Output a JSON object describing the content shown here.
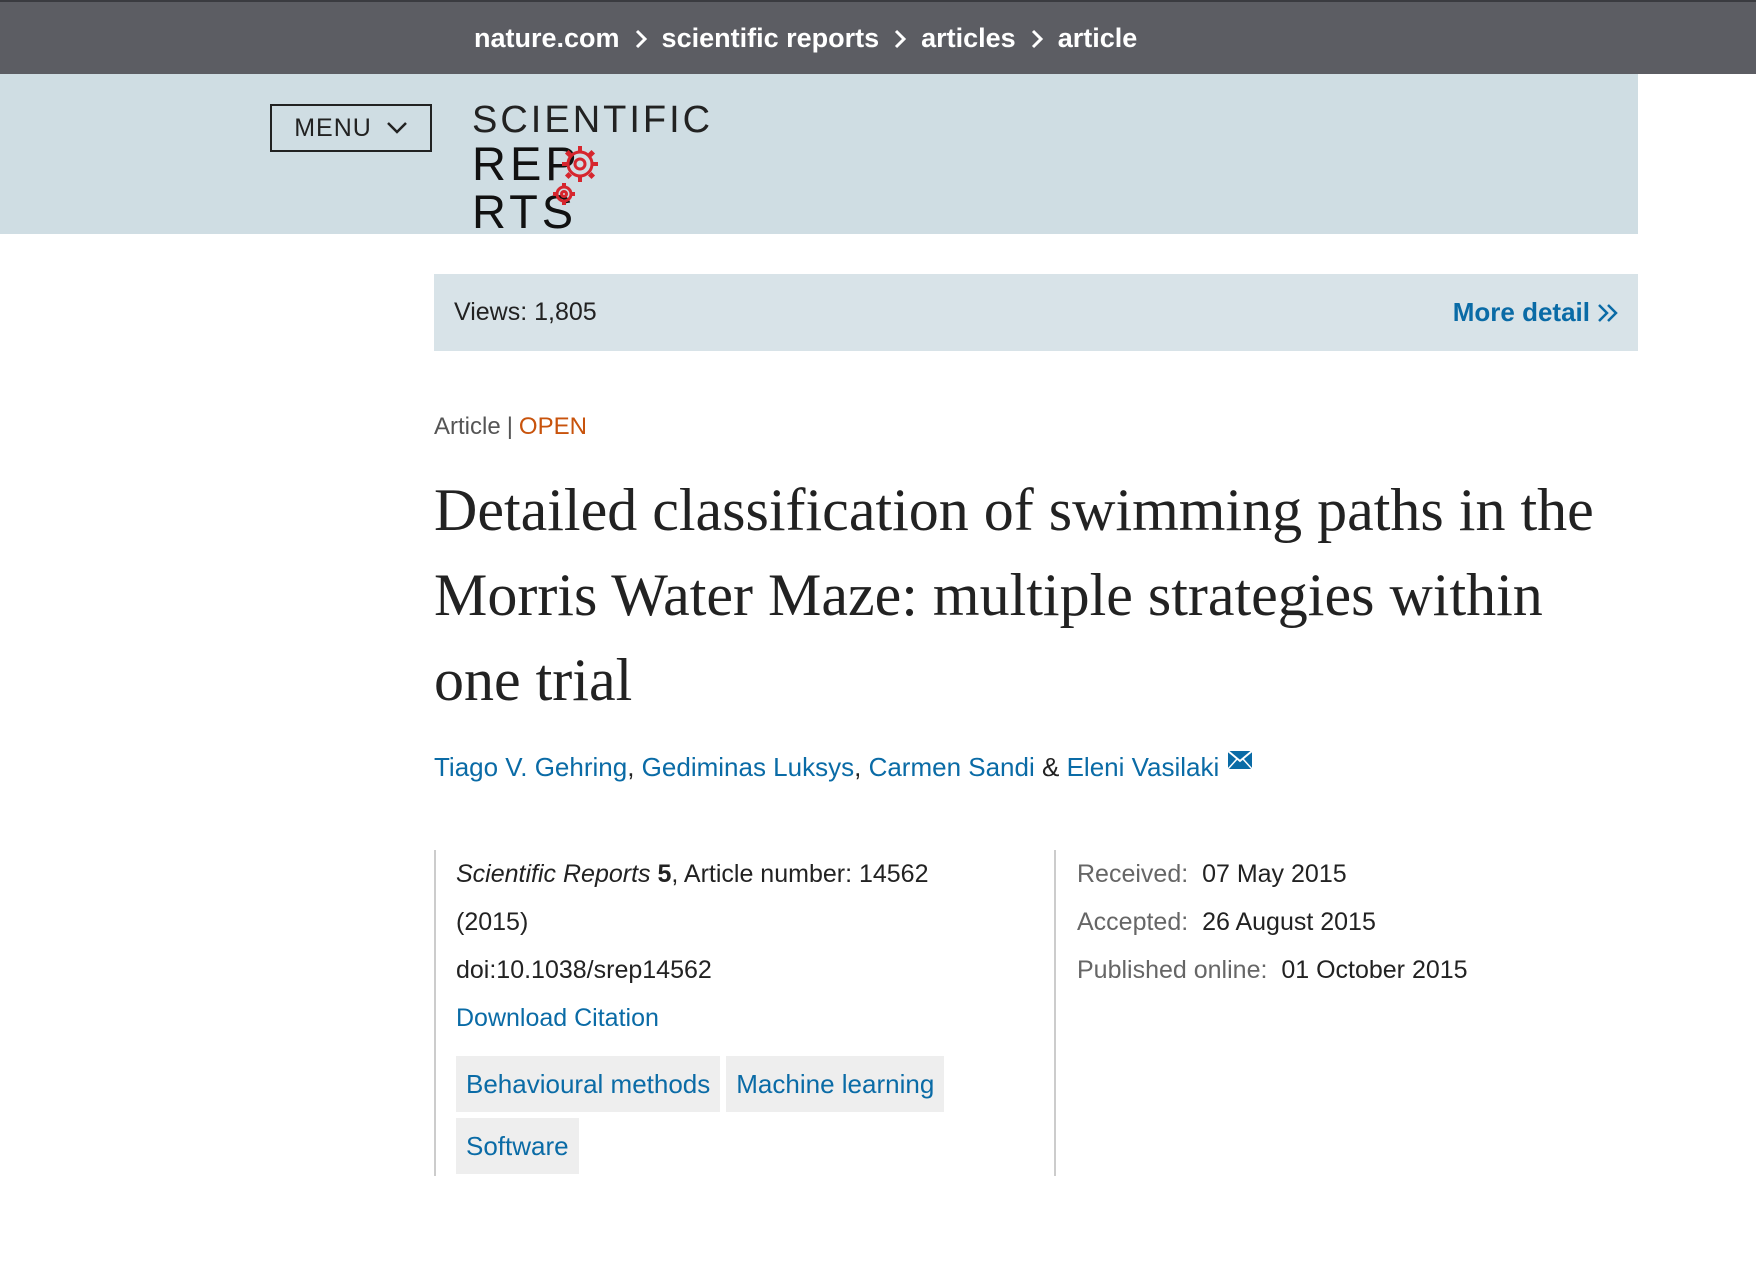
{
  "breadcrumb": {
    "items": [
      "nature.com",
      "scientific reports",
      "articles",
      "article"
    ]
  },
  "header": {
    "menu_label": "MENU",
    "logo_top": "SCIENTIFIC",
    "logo_bottom_left": "REP",
    "logo_bottom_right": "RTS",
    "logo_gear_color": "#d6262e"
  },
  "views": {
    "label": "Views: 1,805",
    "more_detail": "More detail"
  },
  "article": {
    "type": "Article",
    "separator": "|",
    "access": "OPEN",
    "title": "Detailed classification of swimming paths in the Morris Water Maze: multiple strategies within one trial",
    "authors": [
      "Tiago V. Gehring",
      "Gediminas Luksys",
      "Carmen Sandi",
      "Eleni Vasilaki"
    ],
    "author_sep_comma": ",",
    "author_sep_and": "&",
    "journal": "Scientific Reports",
    "volume": "5",
    "article_number": ", Article number: 14562",
    "year": "(2015)",
    "doi": "doi:10.1038/srep14562",
    "download_citation": "Download Citation",
    "subjects": [
      "Behavioural methods",
      "Machine learning",
      "Software"
    ]
  },
  "dates": {
    "received_label": "Received:",
    "received": "07 May 2015",
    "accepted_label": "Accepted:",
    "accepted": "26 August 2015",
    "published_label": "Published online:",
    "published": "01 October 2015"
  },
  "colors": {
    "topbar": "#5c5d63",
    "header": "#cfdde3",
    "link": "#0a6ba6",
    "open": "#c8530c"
  }
}
